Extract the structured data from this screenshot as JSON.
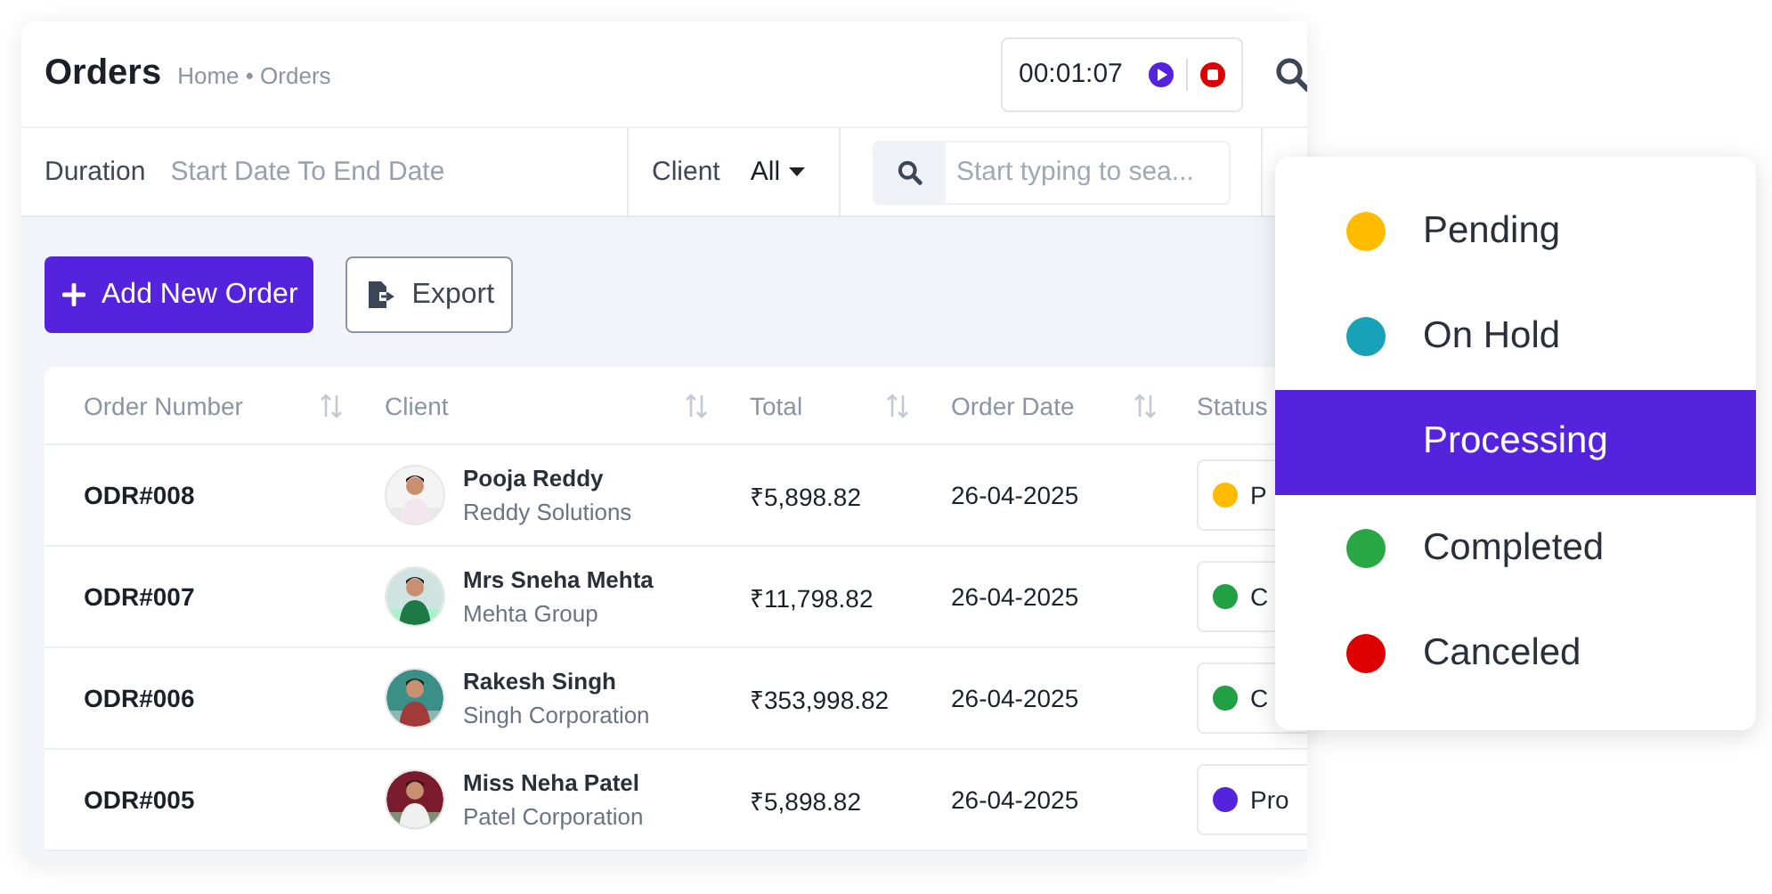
{
  "header": {
    "title": "Orders",
    "breadcrumb": "Home • Orders",
    "timer": "00:01:07"
  },
  "filters": {
    "duration_label": "Duration",
    "date_placeholder": "Start Date To End Date",
    "client_label": "Client",
    "client_value": "All",
    "search_placeholder": "Start typing to sea..."
  },
  "actions": [
    "Add New Order",
    "Export"
  ],
  "table": {
    "columns": [
      "Order Number",
      "Client",
      "Total",
      "Order Date",
      "Status"
    ],
    "rows": [
      {
        "order": "ODR#008",
        "client": "Pooja Reddy",
        "company": "Reddy Solutions",
        "total": "₹5,898.82",
        "date": "26-04-2025",
        "status": "P",
        "color": "#ffbb00"
      },
      {
        "order": "ODR#007",
        "client": "Mrs Sneha Mehta",
        "company": "Mehta Group",
        "total": "₹11,798.82",
        "date": "26-04-2025",
        "status": "C",
        "color": "#22a044"
      },
      {
        "order": "ODR#006",
        "client": "Rakesh Singh",
        "company": "Singh Corporation",
        "total": "₹353,998.82",
        "date": "26-04-2025",
        "status": "C",
        "color": "#22a044"
      },
      {
        "order": "ODR#005",
        "client": "Miss Neha Patel",
        "company": "Patel Corporation",
        "total": "₹5,898.82",
        "date": "26-04-2025",
        "status": "Pro",
        "color": "#5522dd"
      }
    ]
  },
  "status_menu": [
    {
      "label": "Pending",
      "color": "#ffbb00",
      "selected": false
    },
    {
      "label": "On Hold",
      "color": "#17a2b8",
      "selected": false
    },
    {
      "label": "Processing",
      "color": "#5522dd",
      "selected": true
    },
    {
      "label": "Completed",
      "color": "#28a745",
      "selected": false
    },
    {
      "label": "Canceled",
      "color": "#dd0000",
      "selected": false
    }
  ]
}
